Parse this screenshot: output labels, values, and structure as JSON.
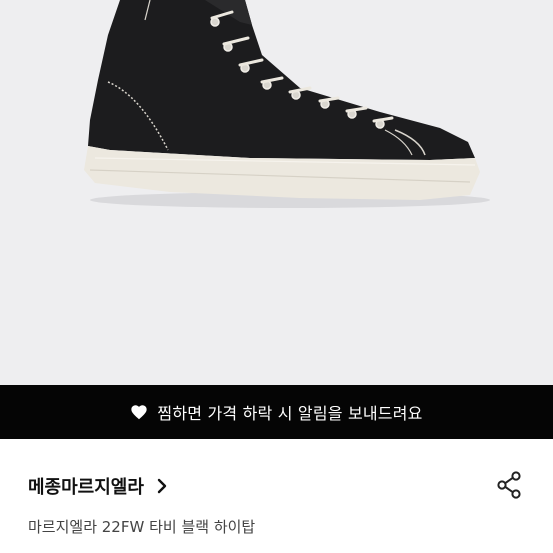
{
  "banner": {
    "text": "찜하면 가격 하락 시 알림을 보내드려요",
    "heart_icon": "heart-icon"
  },
  "product": {
    "brand": "메종마르지엘라",
    "title": "마르지엘라 22FW 타비 블랙 하이탑",
    "brand_chevron_icon": "chevron-right-icon",
    "share_icon": "share-icon",
    "image": "black-canvas-high-top-sneaker"
  },
  "colors": {
    "photo_background": "#eeeef0",
    "banner_background": "#050505",
    "sneaker_canvas": "#1c1c1e",
    "sneaker_sole": "#ece8df"
  }
}
